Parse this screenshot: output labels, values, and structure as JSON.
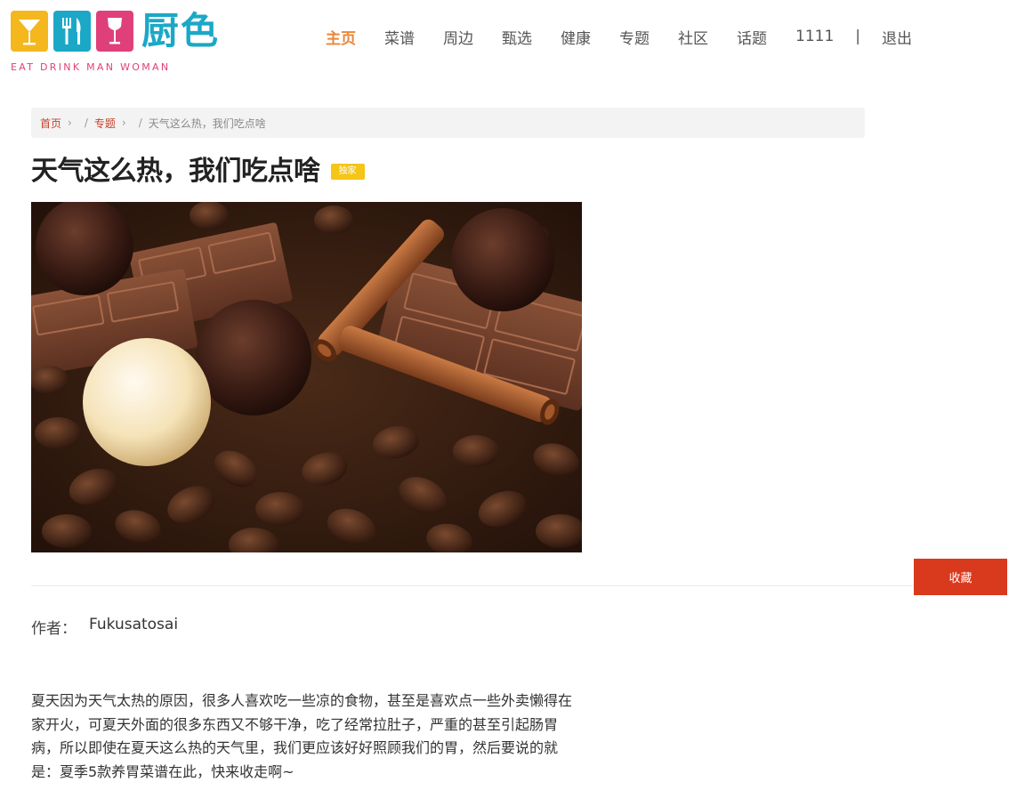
{
  "header": {
    "logo_name": "厨色",
    "logo_tagline": "EAT DRINK MAN WOMAN",
    "nav": {
      "home": "主页",
      "recipes": "菜谱",
      "nearby": "周边",
      "selected": "甄选",
      "health": "健康",
      "topics": "专题",
      "community": "社区",
      "discussions": "话题",
      "user": "1111",
      "separator": "|",
      "logout": "退出"
    }
  },
  "breadcrumb": {
    "home": "首页",
    "topics": "专题",
    "current": "天气这么热，我们吃点啥",
    "sep": "›",
    "slash": "/"
  },
  "article": {
    "title": "天气这么热，我们吃点啥",
    "badge": "独家",
    "favorite_label": "收藏",
    "author_label": "作者：",
    "author_name": "Fukusatosai",
    "body": "夏天因为天气太热的原因，很多人喜欢吃一些凉的食物，甚至是喜欢点一些外卖懒得在家开火，可夏天外面的很多东西又不够干净，吃了经常拉肚子，严重的甚至引起肠胃病，所以即使在夏天这么热的天气里，我们更应该好好照顾我们的胃，然后要说的就是：夏季5款养胃菜谱在此，快来收走啊~"
  },
  "colors": {
    "accent_orange": "#e8873a",
    "brand_cyan": "#1ba8c6",
    "brand_pink": "#e0407a",
    "brand_yellow": "#f4b71d",
    "button_red": "#d9391d",
    "badge_yellow": "#f5c518"
  }
}
